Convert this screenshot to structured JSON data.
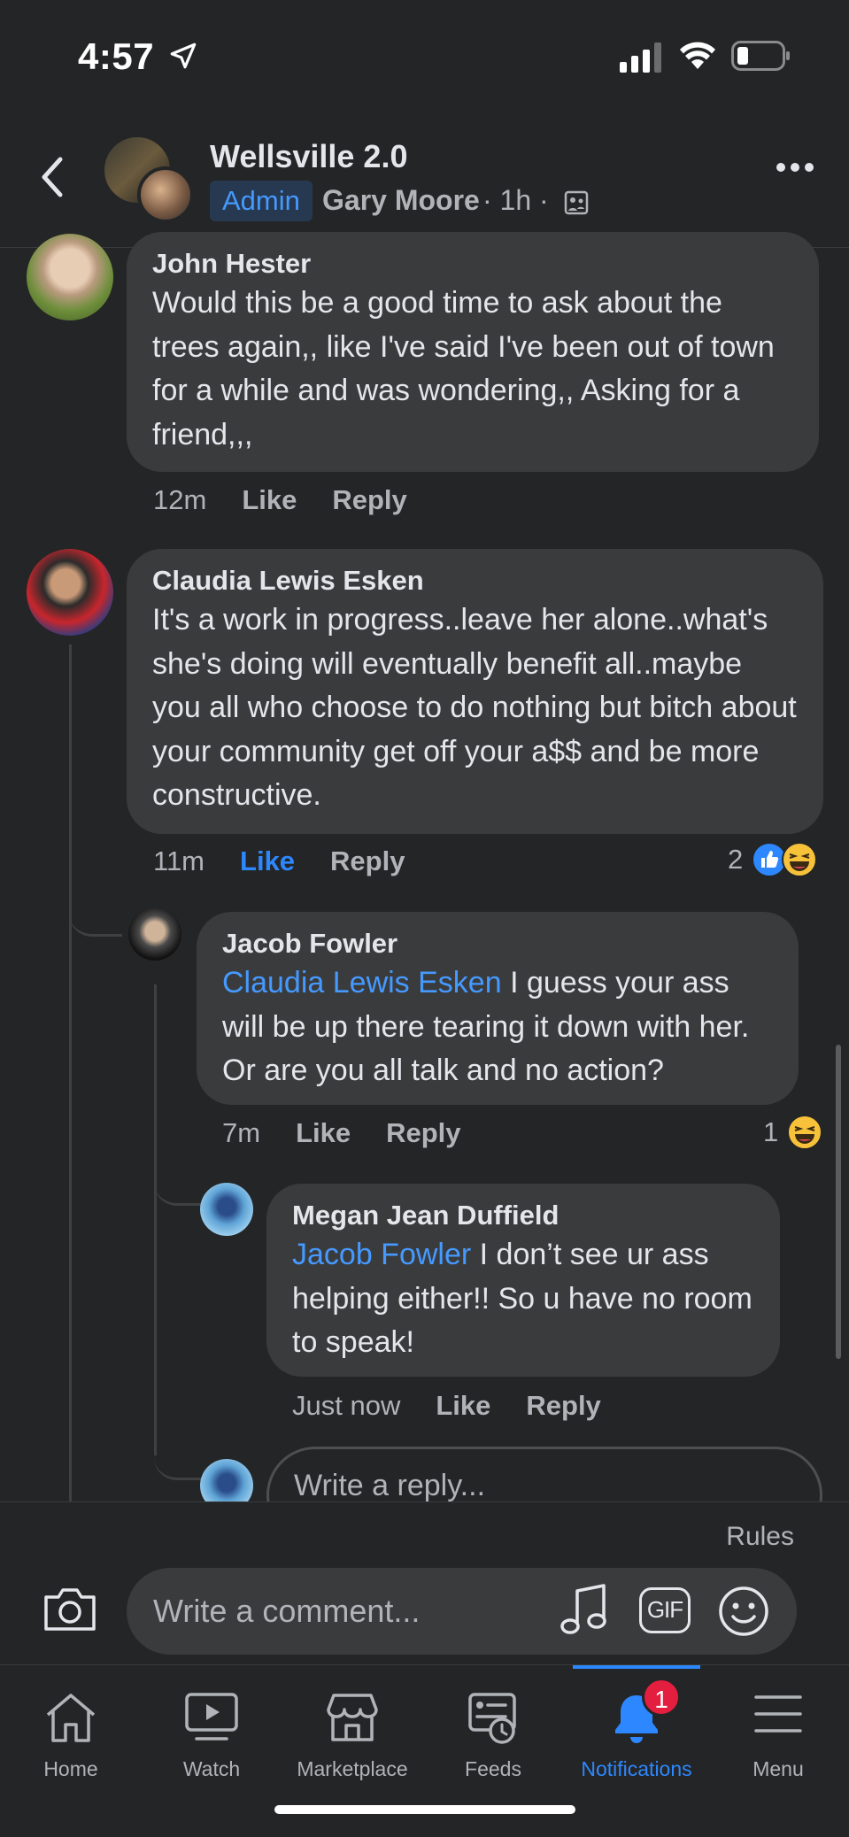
{
  "status_bar": {
    "time": "4:57"
  },
  "header": {
    "group_name": "Wellsville 2.0",
    "badge": "Admin",
    "author": "Gary Moore",
    "meta": "· 1h ·"
  },
  "comments": [
    {
      "name": "John Hester",
      "text": "Would this be a good time to ask about the trees again,, like I've said I've been out of town for a while and was wondering,, Asking for a friend,,,",
      "time": "12m",
      "like": "Like",
      "reply": "Reply"
    },
    {
      "name": "Claudia Lewis Esken",
      "text": "It's a work in progress..leave her alone..what's she's doing will eventually benefit all..maybe you all who choose to do nothing but bitch about your community get off your a$$ and be more constructive.",
      "time": "11m",
      "like": "Like",
      "reply": "Reply",
      "reaction_count": "2"
    },
    {
      "name": "Jacob Fowler",
      "mention": "Claudia Lewis Esken",
      "text": " I guess your ass will be up there tearing it down with her. Or are you all talk and no action?",
      "time": "7m",
      "like": "Like",
      "reply": "Reply",
      "reaction_count": "1"
    },
    {
      "name": "Megan Jean Duffield",
      "mention": "Jacob Fowler",
      "text": " I don’t see ur ass helping either!! So u have no room to speak!",
      "time": "Just now",
      "like": "Like",
      "reply": "Reply"
    }
  ],
  "reply_input": {
    "placeholder": "Write a reply..."
  },
  "composer": {
    "rules": "Rules",
    "placeholder": "Write a comment...",
    "gif": "GIF"
  },
  "tabs": [
    {
      "label": "Home",
      "icon": "home-icon"
    },
    {
      "label": "Watch",
      "icon": "watch-icon"
    },
    {
      "label": "Marketplace",
      "icon": "marketplace-icon"
    },
    {
      "label": "Feeds",
      "icon": "feeds-icon"
    },
    {
      "label": "Notifications",
      "icon": "bell-icon",
      "badge": "1",
      "active": true
    },
    {
      "label": "Menu",
      "icon": "menu-icon"
    }
  ],
  "colors": {
    "accent": "#2d88ff",
    "mention": "#4599ff",
    "badge_red": "#e41e3f",
    "bubble": "#3a3b3c",
    "background": "#242526"
  }
}
